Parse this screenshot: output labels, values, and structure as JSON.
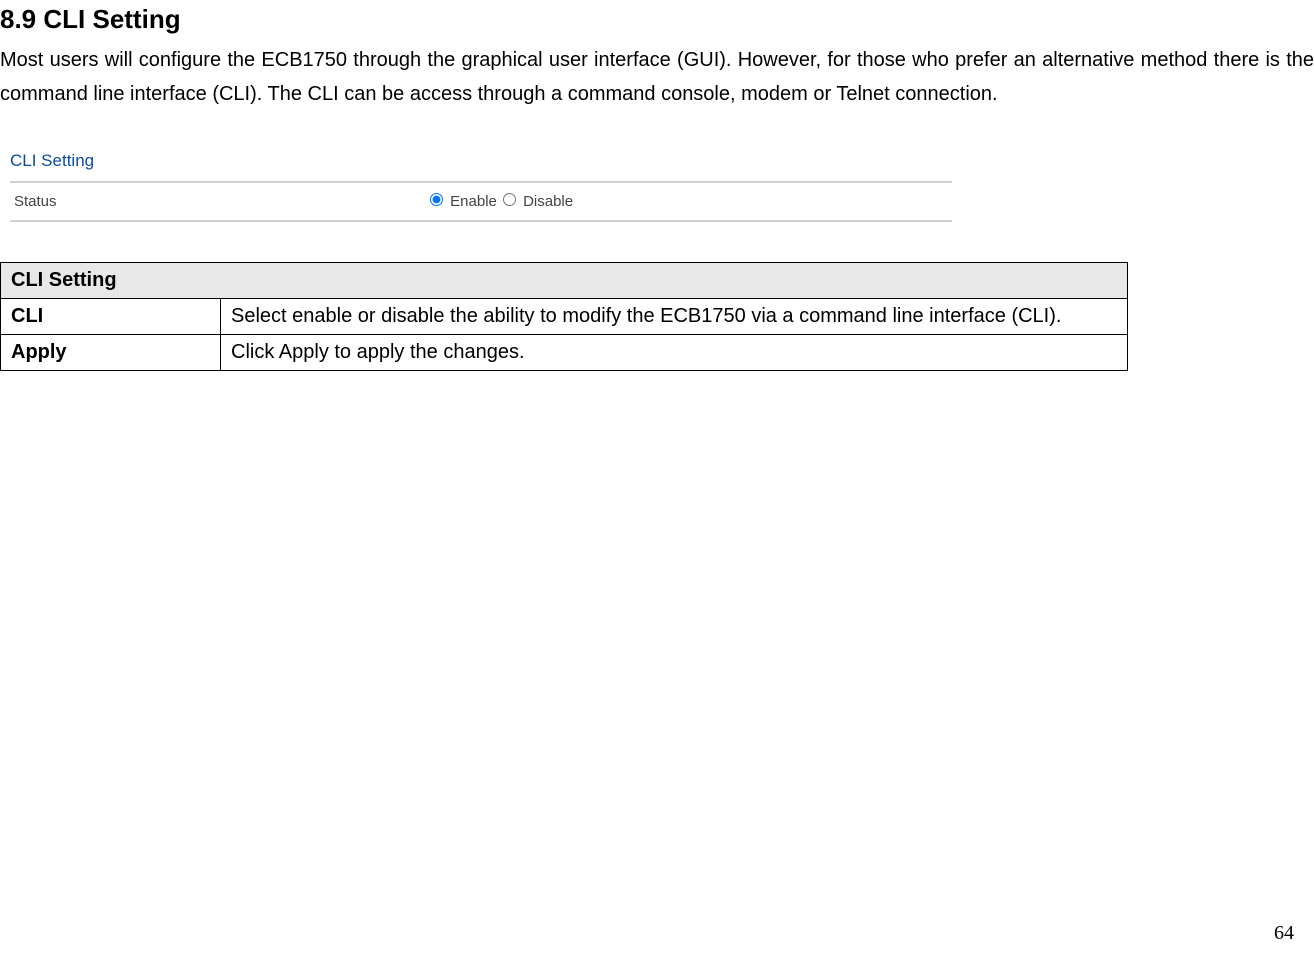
{
  "heading": "8.9   CLI Setting",
  "intro": "Most users will configure the ECB1750 through the graphical user interface (GUI). However, for those who prefer an alternative method there is the command line interface (CLI). The CLI can be access through a command console, modem or Telnet connection.",
  "screenshot": {
    "title": "CLI Setting",
    "row_label": "Status",
    "enable_label": "Enable",
    "disable_label": "Disable"
  },
  "table": {
    "header": "CLI Setting",
    "rows": [
      {
        "label": "CLI",
        "desc": "Select enable or disable the ability to modify the ECB1750 via a command line interface (CLI)."
      },
      {
        "label": "Apply",
        "desc": "Click Apply to apply the changes."
      }
    ]
  },
  "page_number": "64"
}
